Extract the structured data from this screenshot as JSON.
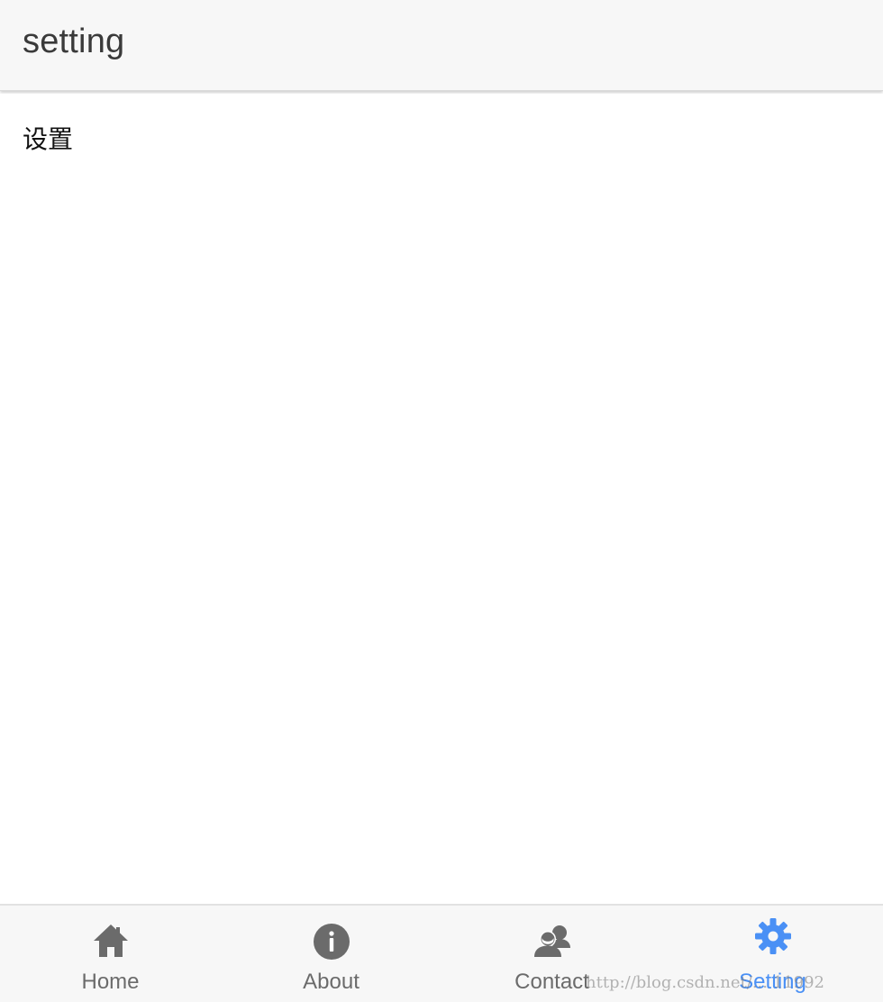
{
  "header": {
    "title": "setting"
  },
  "content": {
    "text": "设置"
  },
  "tabbar": {
    "tabs": [
      {
        "label": "Home",
        "icon": "home-icon",
        "active": false
      },
      {
        "label": "About",
        "icon": "info-icon",
        "active": false
      },
      {
        "label": "Contact",
        "icon": "contacts-icon",
        "active": false
      },
      {
        "label": "Setting",
        "icon": "gear-icon",
        "active": true
      }
    ]
  },
  "watermark": {
    "text": "http://blog.csdn.net/... 11992"
  },
  "colors": {
    "header_bg": "#f7f7f7",
    "tabbar_bg": "#f7f7f7",
    "inactive": "#6b6b6b",
    "active": "#4a90f5"
  }
}
